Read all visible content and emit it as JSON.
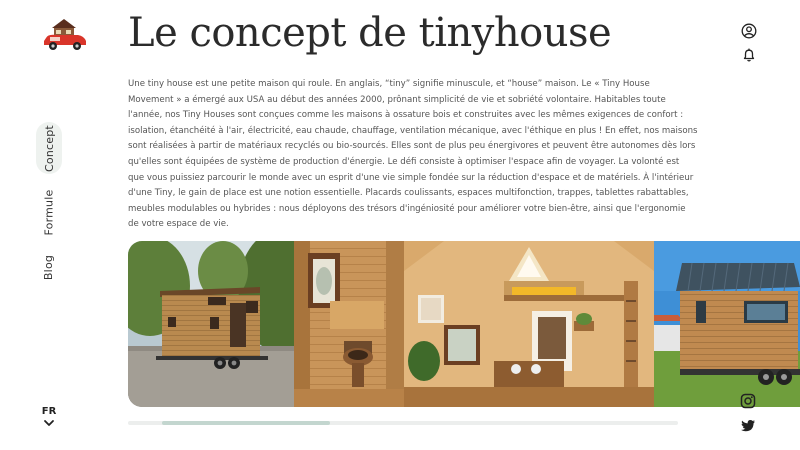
{
  "header": {
    "title": "Le concept de tinyhouse",
    "logo_icon": "tiny-house-on-red-car-logo"
  },
  "nav": {
    "items": [
      {
        "label": "Concept",
        "active": true
      },
      {
        "label": "Formule",
        "active": false
      },
      {
        "label": "Blog",
        "active": false
      }
    ]
  },
  "language": {
    "current": "FR",
    "chevron_icon": "chevron-down-icon"
  },
  "top_icons": [
    "user-circle-icon",
    "bell-icon"
  ],
  "social_icons": [
    "instagram-icon",
    "twitter-icon"
  ],
  "content": {
    "paragraph": "Une tiny house est une petite maison qui roule. En anglais, “tiny” signifie minuscule, et “house” maison. Le « Tiny House Movement » a émergé aux USA au début des années 2000, prônant simplicité de vie et sobriété volontaire. Habitables toute l'année, nos Tiny Houses sont conçues comme les maisons à ossature bois et construites avec les mêmes exigences de confort : isolation, étanchéité à l'air, électricité, eau chaude, chauffage, ventilation mécanique, avec l'éthique en plus ! En effet, nos maisons sont réalisées à partir de matériaux recyclés ou bio-sourcés. Elles sont de plus peu énergivores et peuvent être autonomes dès lors qu'elles sont équipées de système de production d'énergie. Le défi consiste à optimiser l'espace afin de voyager. La volonté est que vous puissiez parcourir le monde avec un esprit d'une vie simple fondée sur la réduction d'espace et de matériels. À l'intérieur d'une Tiny, le gain de place est une notion essentielle. Placards coulissants, espaces multifonction, trappes, tablettes rabattables, meubles modulables ou hybrides : nous déployons des trésors d'ingéniosité pour améliorer votre bien-être, ainsi que l'ergonomie de votre espace de vie."
  },
  "gallery": {
    "photos": [
      "wooden-tiny-house-on-trailer-photo",
      "tiny-house-bathroom-interior-photo",
      "tiny-house-loft-interior-photo",
      "tiny-house-metal-roof-exterior-photo"
    ],
    "scroll_position": 0.06,
    "scroll_visible_fraction": 0.31
  },
  "colors": {
    "accent": "#c3d6cf",
    "active_nav_bg": "#eef2ef",
    "text": "#333333"
  }
}
